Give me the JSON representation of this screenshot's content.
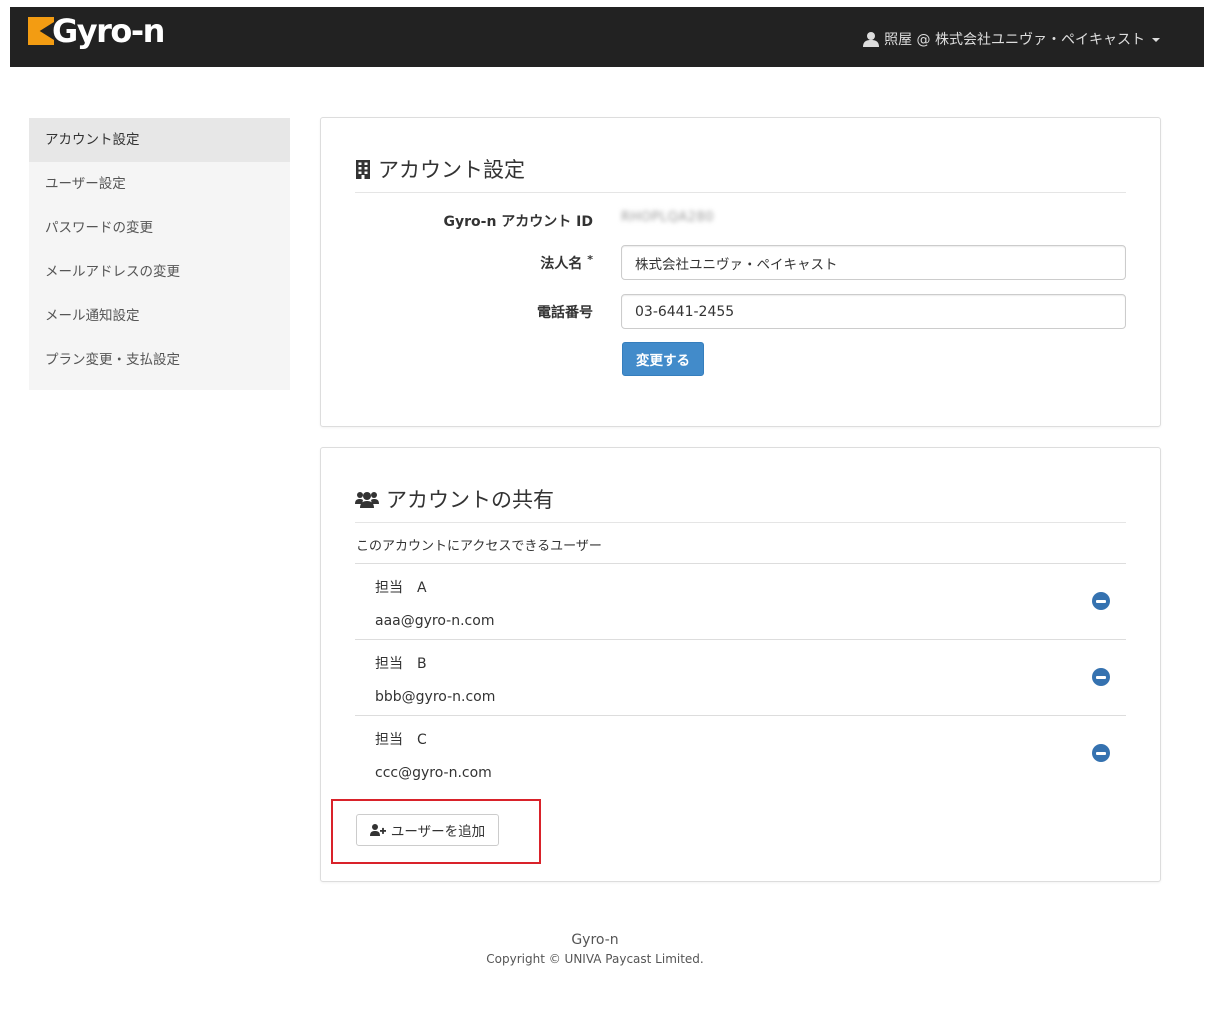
{
  "header": {
    "brand": "Gyro-n",
    "user_menu": "照屋 @ 株式会社ユニヴァ・ペイキャスト"
  },
  "sidebar": {
    "items": [
      {
        "label": "アカウント設定"
      },
      {
        "label": "ユーザー設定"
      },
      {
        "label": "パスワードの変更"
      },
      {
        "label": "メールアドレスの変更"
      },
      {
        "label": "メール通知設定"
      },
      {
        "label": "プラン変更・支払設定"
      }
    ]
  },
  "account": {
    "title": "アカウント設定",
    "id_label": "Gyro-n アカウント ID",
    "id_value": "RHOPLQA280",
    "name_label": "法人名",
    "name_required": "*",
    "name_value": "株式会社ユニヴァ・ペイキャスト",
    "phone_label": "電話番号",
    "phone_value": "03-6441-2455",
    "submit_label": "変更する"
  },
  "sharing": {
    "title": "アカウントの共有",
    "subtitle": "このアカウントにアクセスできるユーザー",
    "users": [
      {
        "name": "担当　A",
        "email": "aaa@gyro-n.com"
      },
      {
        "name": "担当　B",
        "email": "bbb@gyro-n.com"
      },
      {
        "name": "担当　C",
        "email": "ccc@gyro-n.com"
      }
    ],
    "add_label": "ユーザーを追加"
  },
  "footer": {
    "title": "Gyro-n",
    "copyright": "Copyright © UNIVA Paycast Limited."
  },
  "colors": {
    "navbar": "#222222",
    "brand_accent": "#f39c12",
    "primary": "#428bca",
    "highlight": "#d9222a"
  }
}
